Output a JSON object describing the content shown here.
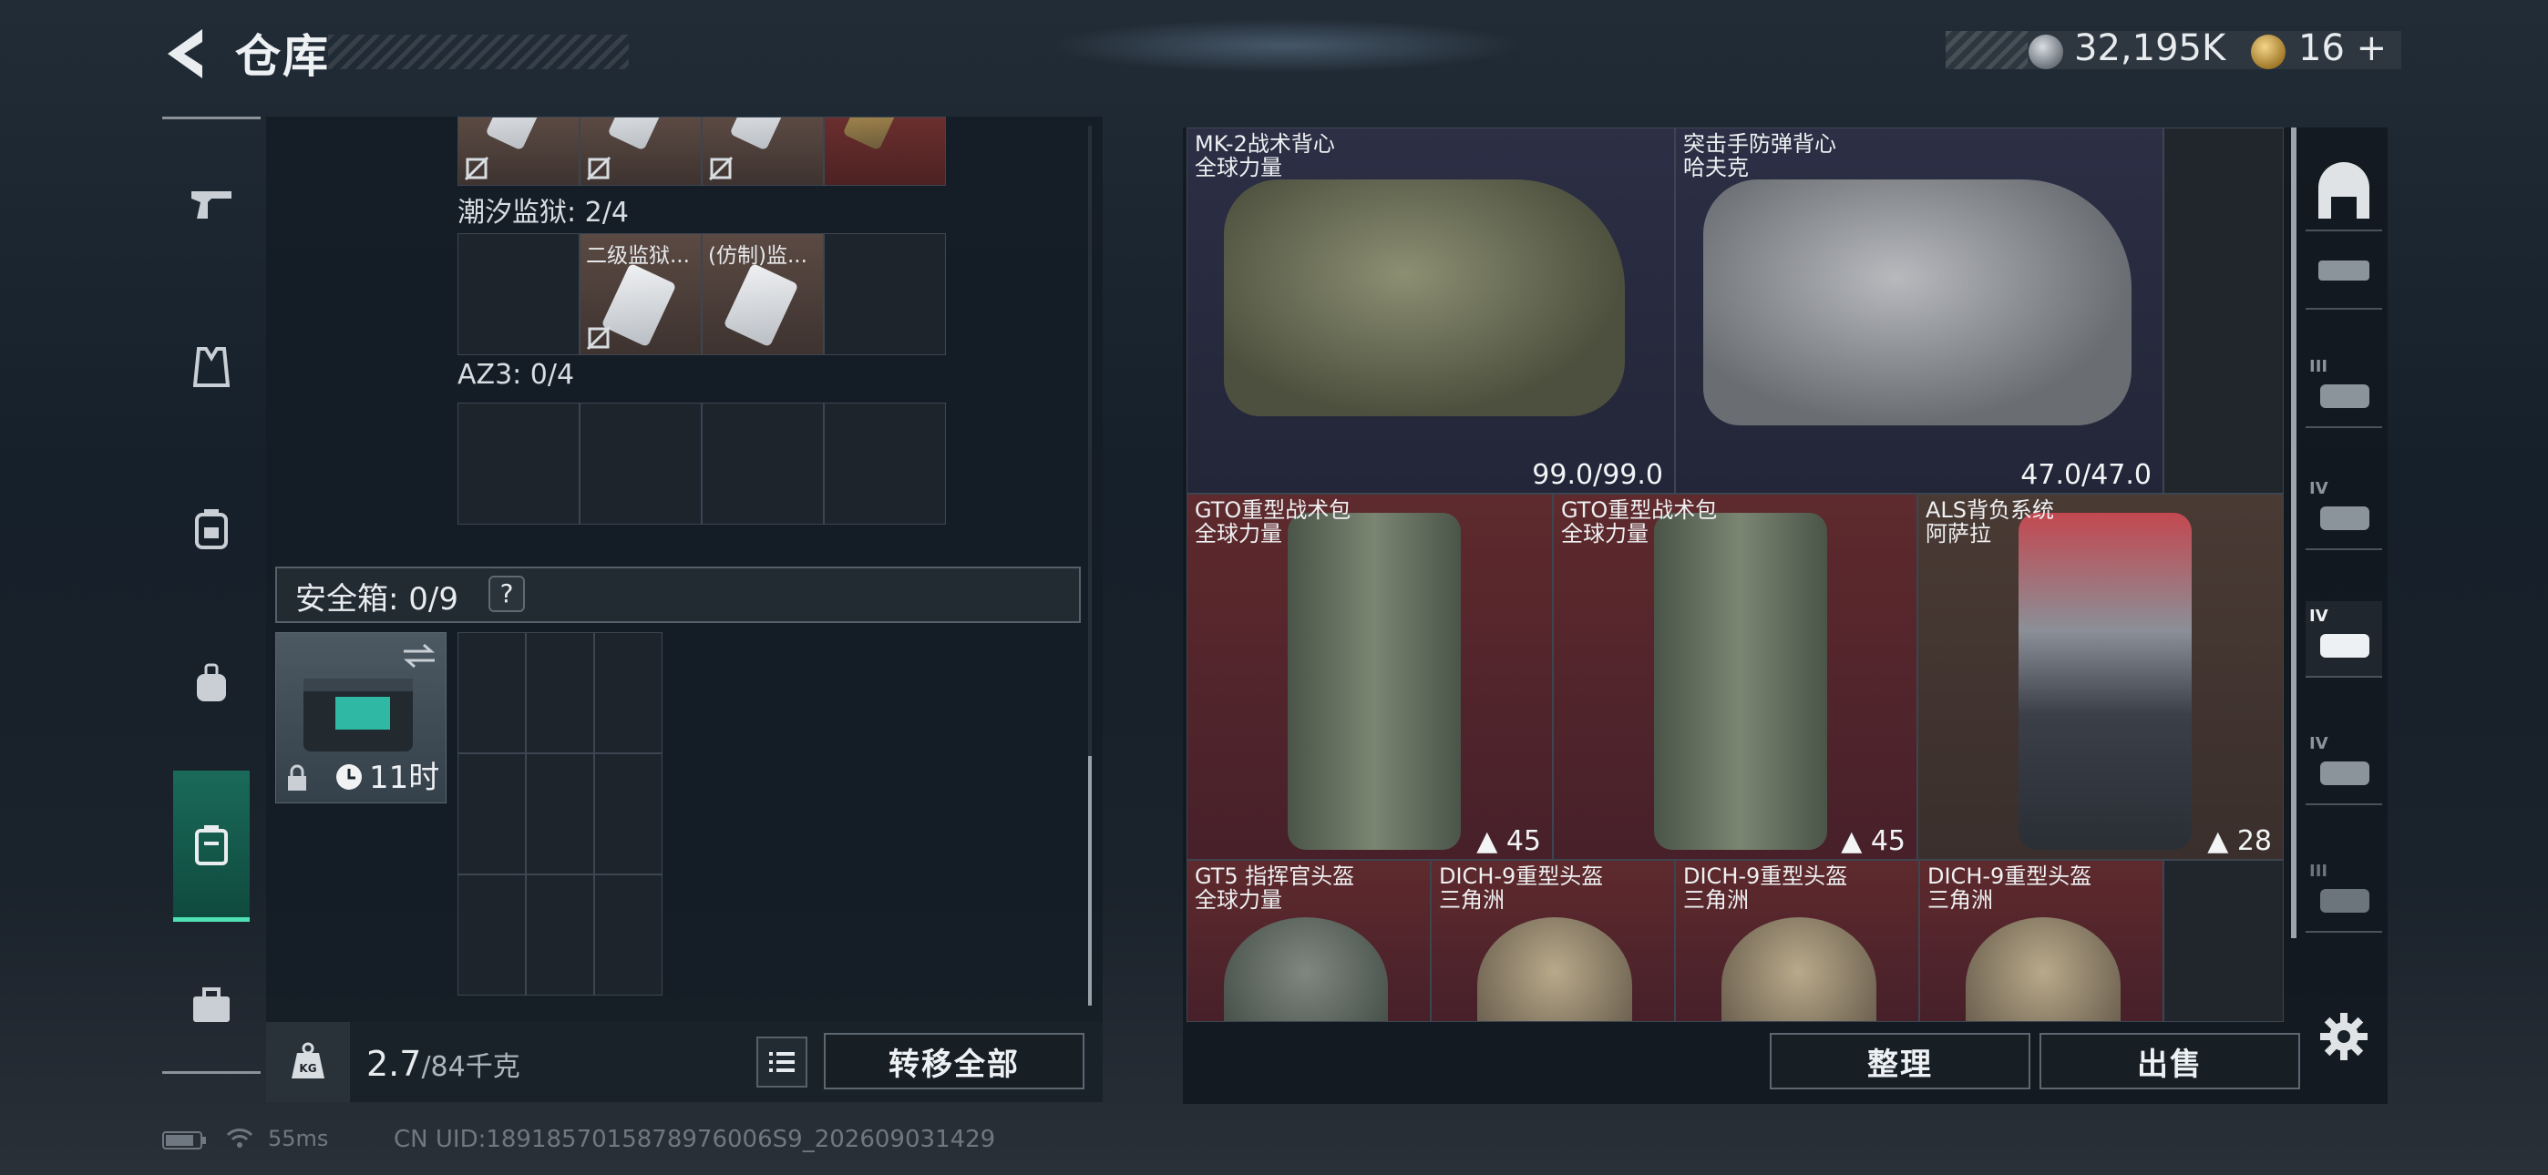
{
  "header": {
    "title": "仓库"
  },
  "currency": {
    "silver": "32,195K",
    "gold": "16",
    "gold_suffix": "+"
  },
  "left_panel": {
    "section1_label": "潮汐监狱: 2/4",
    "section1_items": [
      "二级监狱...",
      "(仿制)监..."
    ],
    "section2_label": "AZ3: 0/4",
    "safe_label": "安全箱: 0/9",
    "safe_help": "?",
    "safe_timer": "11时",
    "weight": "2.7",
    "weight_cap": "/84千克",
    "transfer_all": "转移全部"
  },
  "right_panel": {
    "slots": [
      {
        "name": "MK-2战术背心",
        "sub": "全球力量",
        "value": "99.0/99.0"
      },
      {
        "name": "突击手防弹背心",
        "sub": "哈夫克",
        "value": "47.0/47.0"
      },
      {
        "name": "GTO重型战术包",
        "sub": "全球力量",
        "value": "45"
      },
      {
        "name": "GTO重型战术包",
        "sub": "全球力量",
        "value": "45"
      },
      {
        "name": "ALS背负系统",
        "sub": "阿萨拉",
        "value": "28"
      },
      {
        "name": "GT5 指挥官头盔",
        "sub": "全球力量"
      },
      {
        "name": "DICH-9重型头盔",
        "sub": "三角洲"
      },
      {
        "name": "DICH-9重型头盔",
        "sub": "三角洲"
      },
      {
        "name": "DICH-9重型头盔",
        "sub": "三角洲"
      }
    ],
    "organize": "整理",
    "sell": "出售",
    "tabs": [
      "",
      "",
      "III",
      "IV",
      "IV",
      "IV",
      "III"
    ]
  },
  "status": {
    "ping": "55ms",
    "uid": "CN UID:1891857015878976006S9_202609031429"
  }
}
